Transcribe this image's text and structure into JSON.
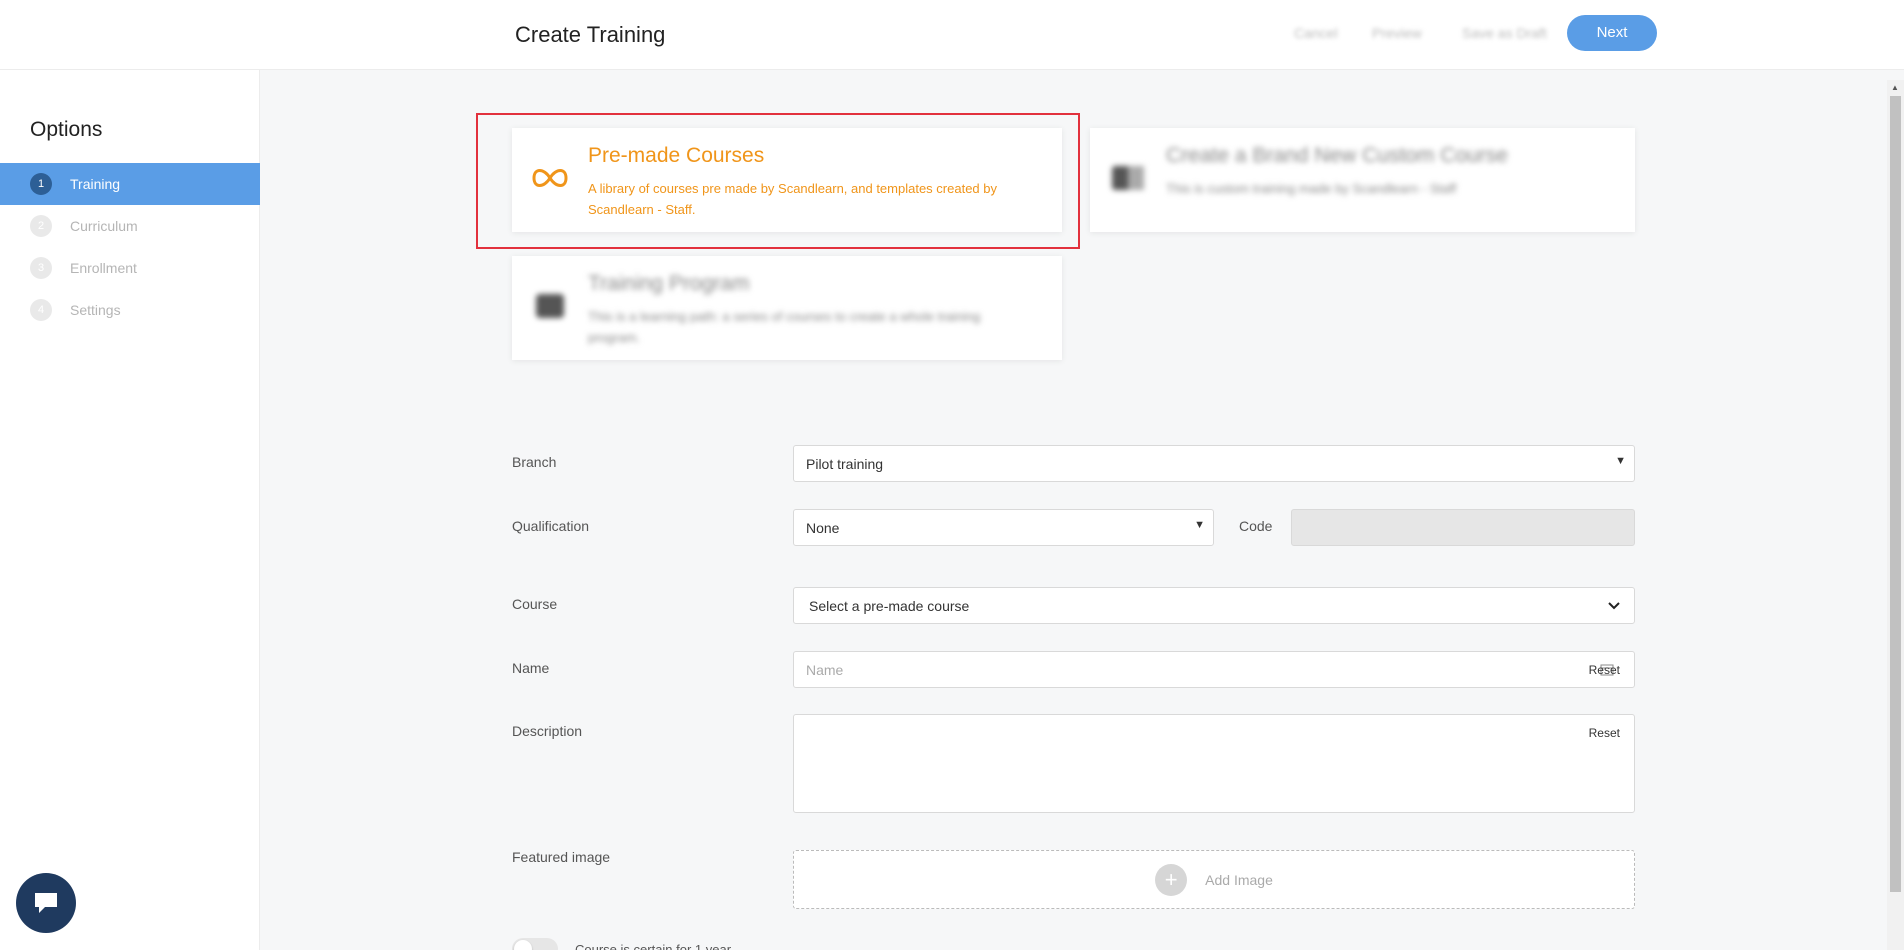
{
  "header": {
    "title": "Create Training",
    "cancel_label": "Cancel",
    "preview_label": "Preview",
    "save_draft_label": "Save as Draft",
    "next_label": "Next"
  },
  "sidebar": {
    "heading": "Options",
    "steps": [
      {
        "num": "1",
        "label": "Training",
        "active": true
      },
      {
        "num": "2",
        "label": "Curriculum",
        "active": false
      },
      {
        "num": "3",
        "label": "Enrollment",
        "active": false
      },
      {
        "num": "4",
        "label": "Settings",
        "active": false
      }
    ]
  },
  "cards": {
    "premade": {
      "title": "Pre-made Courses",
      "description": "A library of courses pre made by Scandlearn, and templates created by Scandlearn - Staff.",
      "icon": "infinity-icon",
      "selected": true
    },
    "custom": {
      "title": "Create a Brand New Custom Course",
      "description": "This is custom training made by Scandlearn - Staff",
      "icon": "custom-course-icon"
    },
    "program": {
      "title": "Training Program",
      "description": "This is a learning path: a series of courses to create a whole training program.",
      "icon": "program-icon"
    }
  },
  "form": {
    "branch_label": "Branch",
    "branch_value": "Pilot training",
    "qualification_label": "Qualification",
    "qualification_value": "None",
    "code_label": "Code",
    "course_label": "Course",
    "course_value": "Select a pre-made course",
    "name_label": "Name",
    "name_placeholder": "Name",
    "name_reset": "Reset",
    "description_label": "Description",
    "description_reset": "Reset",
    "featured_image_label": "Featured image",
    "add_image_label": "Add Image",
    "toggle_label": "Course is certain for 1 year"
  },
  "colors": {
    "accent": "#5a9de6",
    "selected_card": "#f0951a",
    "highlight_border": "#e2313d",
    "chat": "#1f3a5f"
  }
}
